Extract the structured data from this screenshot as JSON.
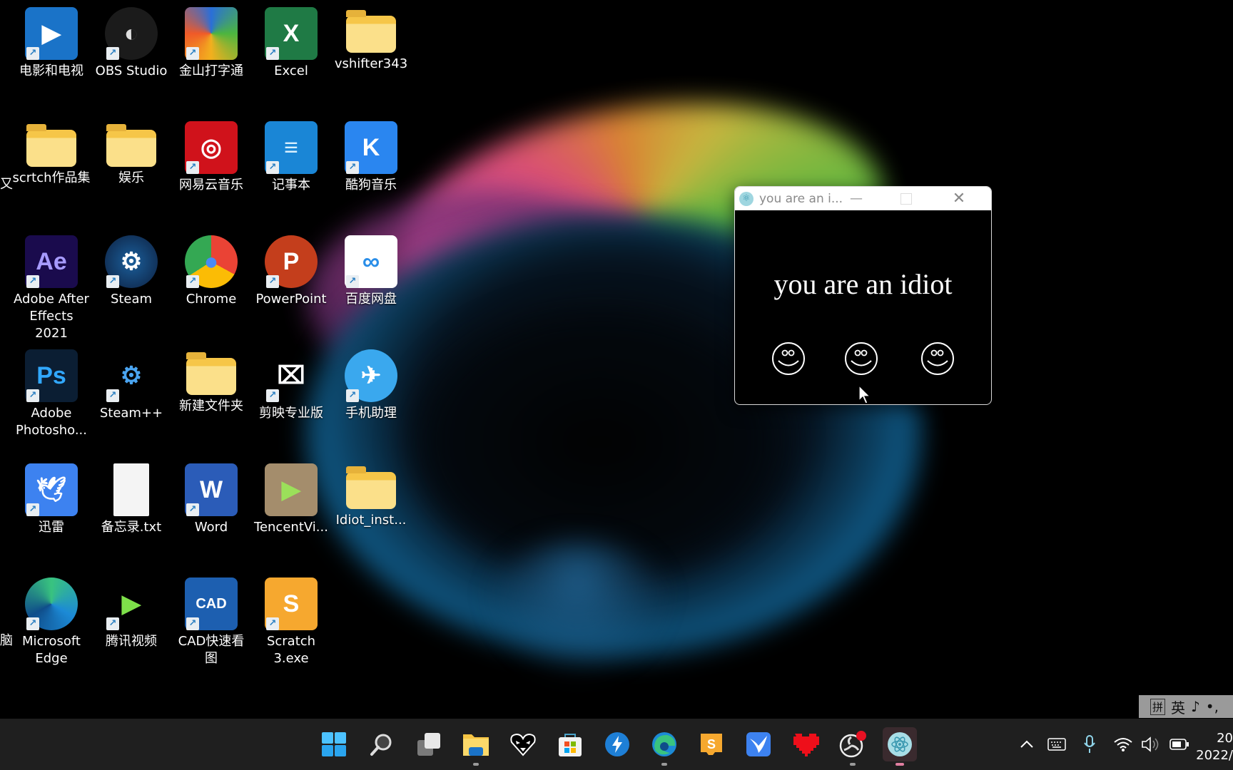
{
  "desktop": {
    "icons": [
      {
        "label": "电影和电视",
        "icon": "movies-tv-icon",
        "shortcut": true
      },
      {
        "label": "OBS Studio",
        "icon": "obs-icon",
        "shortcut": true
      },
      {
        "label": "金山打字通",
        "icon": "jinshan-typing-icon",
        "shortcut": true
      },
      {
        "label": "Excel",
        "icon": "excel-icon",
        "shortcut": true
      },
      {
        "label": "vshifter343",
        "icon": "folder-icon",
        "shortcut": false
      },
      {
        "label": "scrtch作品集",
        "icon": "folder-icon",
        "shortcut": false
      },
      {
        "label": "娱乐",
        "icon": "folder-icon",
        "shortcut": false
      },
      {
        "label": "网易云音乐",
        "icon": "netease-music-icon",
        "shortcut": true
      },
      {
        "label": "记事本",
        "icon": "notepad-icon",
        "shortcut": true
      },
      {
        "label": "酷狗音乐",
        "icon": "kugou-icon",
        "shortcut": true
      },
      {
        "label": "Adobe After\nEffects 2021",
        "icon": "after-effects-icon",
        "shortcut": true
      },
      {
        "label": "Steam",
        "icon": "steam-icon",
        "shortcut": true
      },
      {
        "label": "Chrome",
        "icon": "chrome-icon",
        "shortcut": true
      },
      {
        "label": "PowerPoint",
        "icon": "powerpoint-icon",
        "shortcut": true
      },
      {
        "label": "百度网盘",
        "icon": "baidu-netdisk-icon",
        "shortcut": true
      },
      {
        "label": "Adobe\nPhotosho...",
        "icon": "photoshop-icon",
        "shortcut": true
      },
      {
        "label": "Steam++",
        "icon": "steam-plus-icon",
        "shortcut": true
      },
      {
        "label": "新建文件夹",
        "icon": "folder-icon",
        "shortcut": false
      },
      {
        "label": "剪映专业版",
        "icon": "capcut-icon",
        "shortcut": true
      },
      {
        "label": "手机助理",
        "icon": "phone-assistant-icon",
        "shortcut": true
      },
      {
        "label": "迅雷",
        "icon": "xunlei-icon",
        "shortcut": true
      },
      {
        "label": "备忘录.txt",
        "icon": "text-file-icon",
        "shortcut": false
      },
      {
        "label": "Word",
        "icon": "word-icon",
        "shortcut": true
      },
      {
        "label": "TencentVi...",
        "icon": "tencent-video-installer-icon",
        "shortcut": false
      },
      {
        "label": "Idiot_inst...",
        "icon": "folder-icon",
        "shortcut": false
      },
      {
        "label": "Microsoft\nEdge",
        "icon": "edge-icon",
        "shortcut": true
      },
      {
        "label": "腾讯视频",
        "icon": "tencent-video-icon",
        "shortcut": true
      },
      {
        "label": "CAD快速看\n图",
        "icon": "cad-viewer-icon",
        "shortcut": true
      },
      {
        "label": "Scratch\n3.exe",
        "icon": "scratch-icon",
        "shortcut": true
      }
    ],
    "cut_labels": [
      "又",
      "脑"
    ]
  },
  "window": {
    "title": "you are an i...",
    "message": "you are an idiot",
    "smiley_count": 3
  },
  "ime": {
    "mode1": "拼",
    "mode2": "英",
    "mode3": "♪",
    "mode4": "•,"
  },
  "taskbar": {
    "items": [
      {
        "name": "start-button",
        "icon": "windows-start-icon"
      },
      {
        "name": "search-button",
        "icon": "search-icon"
      },
      {
        "name": "task-view-button",
        "icon": "task-view-icon"
      },
      {
        "name": "file-explorer-button",
        "icon": "folder-icon",
        "running": true
      },
      {
        "name": "heart-mask-app-button",
        "icon": "heart-mask-icon"
      },
      {
        "name": "microsoft-store-button",
        "icon": "store-icon"
      },
      {
        "name": "thunder-app-button",
        "icon": "lightning-icon"
      },
      {
        "name": "edge-button",
        "icon": "edge-icon",
        "running": true
      },
      {
        "name": "scratch-button",
        "icon": "scratch-icon"
      },
      {
        "name": "xunlei-button",
        "icon": "xunlei-icon"
      },
      {
        "name": "red-heart-app-button",
        "icon": "red-heart-icon"
      },
      {
        "name": "obs-button",
        "icon": "obs-icon",
        "running": true,
        "badge": true
      },
      {
        "name": "electron-app-button",
        "icon": "electron-icon",
        "running": true,
        "active": true
      }
    ],
    "tray": {
      "chevron": "^",
      "clock_line1": "20",
      "clock_line2": "2022/"
    }
  },
  "colors": {
    "taskbar_bg": "#1f1f1f",
    "window_titlebar": "#ffffff",
    "window_body": "#000000",
    "active_indicator": "#e07ea0",
    "obs_badge": "#e81123"
  }
}
